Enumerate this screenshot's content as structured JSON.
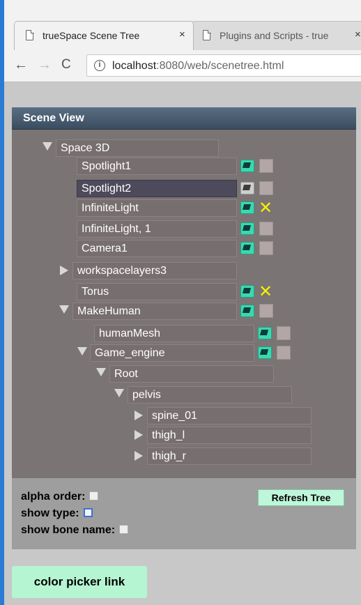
{
  "browser": {
    "tabs": [
      {
        "label": "trueSpace Scene Tree",
        "close": "×"
      },
      {
        "label": "Plugins and Scripts - true",
        "close": "×"
      }
    ],
    "nav": {
      "back": "←",
      "forward": "→",
      "reload": "C"
    },
    "url": {
      "info": "i",
      "host": "localhost",
      "path": ":8080/web/scenetree.html"
    }
  },
  "panel": {
    "title": "Scene View",
    "tree": [
      {
        "label": "Space 3D"
      },
      {
        "label": "Spotlight1"
      },
      {
        "label": "Spotlight2"
      },
      {
        "label": "InfiniteLight"
      },
      {
        "label": "InfiniteLight, 1"
      },
      {
        "label": "Camera1"
      },
      {
        "label": "workspacelayers3"
      },
      {
        "label": "Torus"
      },
      {
        "label": "MakeHuman"
      },
      {
        "label": "humanMesh"
      },
      {
        "label": "Game_engine"
      },
      {
        "label": "Root"
      },
      {
        "label": "pelvis"
      },
      {
        "label": "spine_01"
      },
      {
        "label": "thigh_l"
      },
      {
        "label": "thigh_r"
      }
    ],
    "options": {
      "alpha_order": "alpha order:",
      "show_type": "show type:",
      "show_bone_name": "show bone name:"
    },
    "refresh_label": "Refresh Tree"
  },
  "color_picker_label": "color picker link",
  "colors": {
    "visible_icon": "#3ad9b0",
    "selected_x": "#f6f000",
    "header": "#3b4d60",
    "button_bg": "#b5f5d2"
  }
}
